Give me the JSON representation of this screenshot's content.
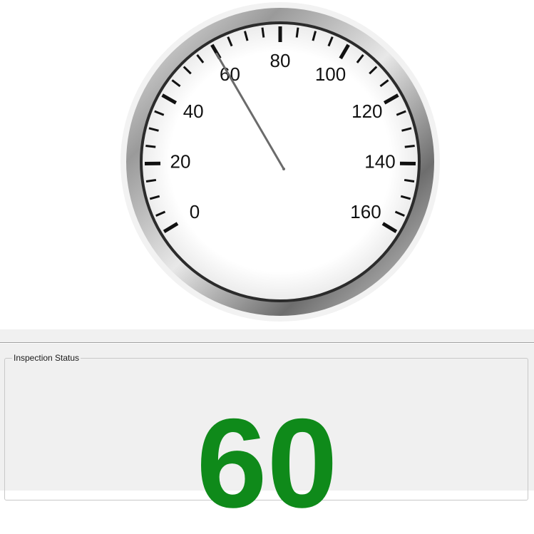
{
  "gauge": {
    "value": 60,
    "min": 0,
    "max": 160,
    "major_step": 20,
    "minor_divisions": 4,
    "tick_labels": [
      "0",
      "20",
      "40",
      "60",
      "80",
      "100",
      "120",
      "140",
      "160"
    ]
  },
  "status_panel": {
    "title": "Inspection Status",
    "value": "60",
    "value_color": "#0f8a1a"
  }
}
